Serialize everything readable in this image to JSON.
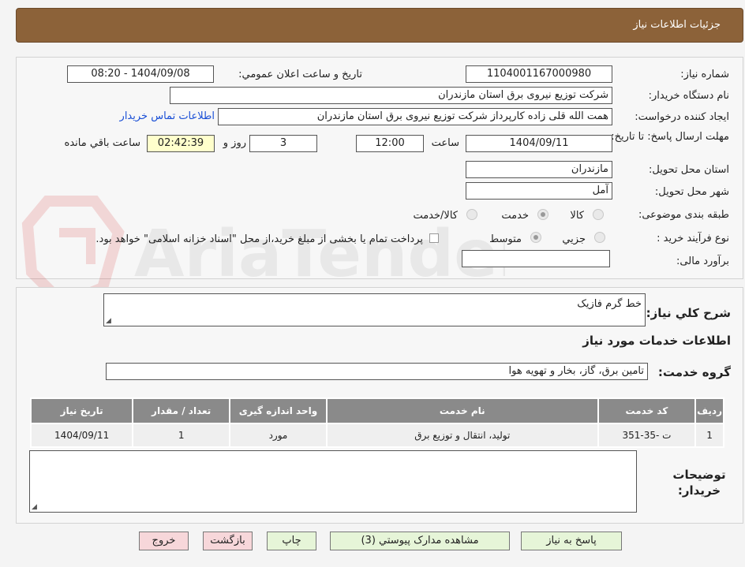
{
  "header": {
    "title": "جزئیات اطلاعات نیاز"
  },
  "watermark": {
    "text": "AriaTender.net"
  },
  "form": {
    "need_number_label": "شماره نياز:",
    "need_number": "1104001167000980",
    "announce_label": "تاريخ و ساعت اعلان عمومي:",
    "announce_value": "1404/09/08 - 08:20",
    "buyer_org_label": "نام دستگاه خريدار:",
    "buyer_org": "شرکت توزیع نیروی برق استان مازندران",
    "creator_label": "ايجاد کننده درخواست:",
    "creator": "همت الله قلی زاده کارپرداز شرکت توزیع نیروی برق استان مازندران",
    "contact_link": "اطلاعات تماس خريدار",
    "deadline_label": "مهلت ارسال پاسخ: تا تاريخ:",
    "deadline_date": "1404/09/11",
    "time_label": "ساعت",
    "deadline_time": "12:00",
    "days_value": "3",
    "days_label": "روز و",
    "remaining_time": "02:42:39",
    "remaining_label": "ساعت باقي مانده",
    "province_label": "استان محل تحويل:",
    "province": "مازندران",
    "city_label": "شهر محل تحويل:",
    "city": "آمل",
    "category_label": "طبقه بندی موضوعی:",
    "category_options": [
      "کالا",
      "خدمت",
      "کالا/خدمت"
    ],
    "process_label": "نوع فرآيند خريد :",
    "process_options": [
      "جزيي",
      "متوسط"
    ],
    "payment_note": "پرداخت تمام يا بخشی از مبلغ خريد،از محل \"اسناد خزانه اسلامی\" خواهد بود.",
    "budget_label": "برآورد مالی:",
    "budget_value": ""
  },
  "description": {
    "label": "شرح کلي نياز:",
    "value": "خط گرم فازیک"
  },
  "services": {
    "section_title": "اطلاعات خدمات مورد نياز",
    "group_label": "گروه خدمت:",
    "group_value": "تامين برق، گاز، بخار و تهويه هوا",
    "columns": [
      "رديف",
      "کد خدمت",
      "نام خدمت",
      "واحد اندازه گيری",
      "تعداد / مقدار",
      "تاريخ نياز"
    ],
    "rows": [
      [
        "1",
        "ت -35-351",
        "توليد، انتقال و توزيع برق",
        "مورد",
        "1",
        "1404/09/11"
      ]
    ]
  },
  "buyer_notes": {
    "label": "توضيحات خريدار:",
    "value": ""
  },
  "buttons": {
    "reply": "پاسخ به نياز",
    "attachments": "مشاهده مدارک پيوستي (3)",
    "print": "چاپ",
    "back": "بازگشت",
    "exit": "خروج"
  },
  "colors": {
    "header_bg": "#8c6239",
    "link": "#1a4fd6",
    "remaining_bg": "#ffffcc",
    "table_header": "#8a8a8a"
  }
}
